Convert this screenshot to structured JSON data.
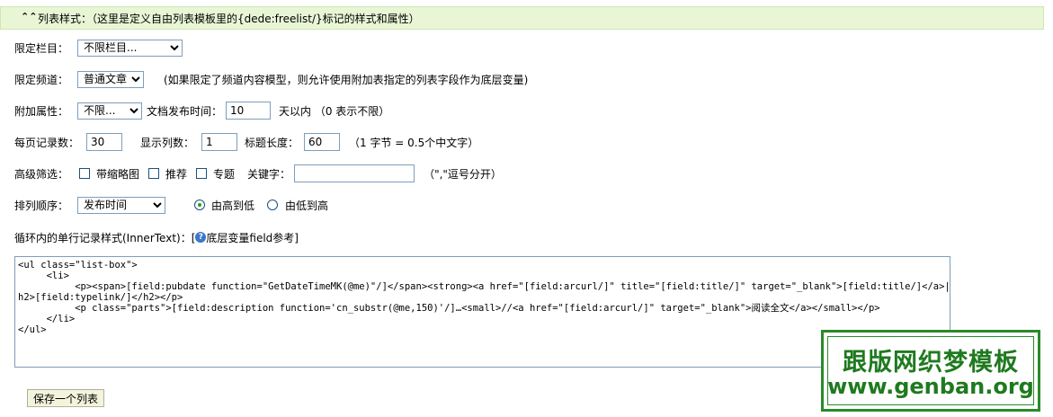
{
  "header": {
    "toggle_icon": "double-chevron-up",
    "title": "列表样式：（这里是定义自由列表模板里的{dede:freelist/}标记的样式和属性）"
  },
  "column": {
    "label": "限定栏目：",
    "selected": "不限栏目..."
  },
  "channel": {
    "label": "限定频道：",
    "selected": "普通文章",
    "note": "(如果限定了频道内容模型，则允许使用附加表指定的列表字段作为底层变量)"
  },
  "attr": {
    "label": "附加属性：",
    "selected": "不限...",
    "pubtime_label": "文档发布时间：",
    "pubtime_value": "10",
    "pubtime_suffix": "天以内 （0 表示不限）"
  },
  "paging": {
    "per_page_label": "每页记录数：",
    "per_page_value": "30",
    "cols_label": "显示列数：",
    "cols_value": "1",
    "title_len_label": "标题长度：",
    "title_len_value": "60",
    "title_len_note": "（1 字节 = 0.5个中文字）"
  },
  "filter": {
    "label": "高级筛选：",
    "thumb_label": "带缩略图",
    "thumb_checked": false,
    "recommend_label": "推荐",
    "recommend_checked": false,
    "special_label": "专题",
    "special_checked": false,
    "keyword_label": "关键字：",
    "keyword_value": "",
    "keyword_note": "（\",\"逗号分开）"
  },
  "sort": {
    "label": "排列顺序：",
    "selected": "发布时间",
    "desc_label": "由高到低",
    "desc_checked": true,
    "asc_label": "由低到高",
    "asc_checked": false
  },
  "innertext": {
    "label": "循环内的单行记录样式(InnerText)：[",
    "help_icon": "help-icon",
    "help_link": "底层变量field参考]",
    "code": "<ul class=\"list-box\">\n     <li>\n          <p><span>[field:pubdate function=\"GetDateTimeMK(@me)\"/]</span><strong><a href=\"[field:arcurl/]\" title=\"[field:title/]\" target=\"_blank\">[field:title/]</a>|</strong><\nh2>[field:typelink/]</h2></p>\n          <p class=\"parts\">[field:description function='cn_substr(@me,150)'/]…<small>//<a href=\"[field:arcurl/]\" target=\"_blank\">阅读全文</a></small></p>\n     </li>\n</ul>"
  },
  "save_button": "保存一个列表",
  "watermark": {
    "cn": "跟版网织梦模板",
    "url": "www.genban.org"
  },
  "colors": {
    "header_bg": "#e9f6d6",
    "watermark_green": "#1f7a1f",
    "input_border": "#7f9db9"
  }
}
